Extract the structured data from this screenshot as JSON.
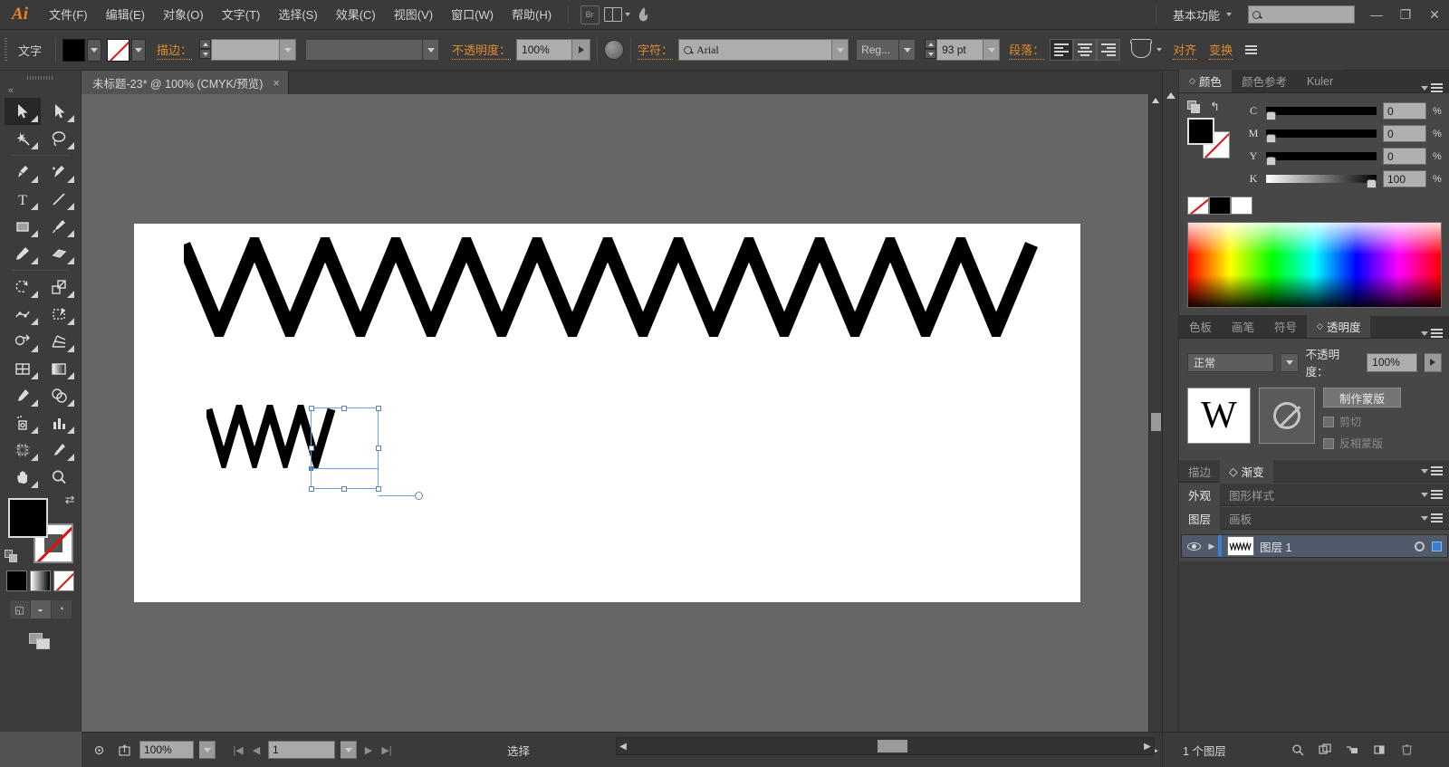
{
  "app": {
    "logo": "Ai"
  },
  "menubar": {
    "items": [
      {
        "label": "文件(F)"
      },
      {
        "label": "编辑(E)"
      },
      {
        "label": "对象(O)"
      },
      {
        "label": "文字(T)"
      },
      {
        "label": "选择(S)"
      },
      {
        "label": "效果(C)"
      },
      {
        "label": "视图(V)"
      },
      {
        "label": "窗口(W)"
      },
      {
        "label": "帮助(H)"
      }
    ],
    "bridge_label": "Br",
    "workspace": "基本功能",
    "search_placeholder": "",
    "window_buttons": {
      "minimize": "—",
      "restore": "❐",
      "close": "✕"
    }
  },
  "controlbar": {
    "tool_label": "文字",
    "fill_swatch": "black",
    "stroke_swatch": "none",
    "stroke_label": "描边：",
    "stroke_weight": "",
    "stroke_profile": "",
    "opacity_label": "不透明度：",
    "opacity_value": "100%",
    "char_label": "字符：",
    "font_family": "Arial",
    "font_style": "Reg...",
    "font_size": "93 pt",
    "paragraph_label": "段落：",
    "align_label": "对齐",
    "transform_label": "变换"
  },
  "documenttab": {
    "title": "未标题-23* @ 100% (CMYK/预览)",
    "close": "×"
  },
  "toolbar": {
    "tools": [
      {
        "name": "selection-tool",
        "active": true
      },
      {
        "name": "direct-selection-tool",
        "active": false
      },
      {
        "name": "magic-wand-tool",
        "active": false
      },
      {
        "name": "lasso-tool",
        "active": false
      },
      {
        "name": "pen-tool",
        "active": false
      },
      {
        "name": "add-anchor-point-tool",
        "active": false
      },
      {
        "name": "type-tool",
        "active": false
      },
      {
        "name": "line-segment-tool",
        "active": false
      },
      {
        "name": "rectangle-tool",
        "active": false
      },
      {
        "name": "paintbrush-tool",
        "active": false
      },
      {
        "name": "pencil-tool",
        "active": false
      },
      {
        "name": "blob-brush-tool",
        "active": false
      },
      {
        "name": "rotate-tool",
        "active": false
      },
      {
        "name": "scale-tool",
        "active": false
      },
      {
        "name": "width-tool",
        "active": false
      },
      {
        "name": "free-transform-tool",
        "active": false
      },
      {
        "name": "shape-builder-tool",
        "active": false
      },
      {
        "name": "perspective-grid-tool",
        "active": false
      },
      {
        "name": "mesh-tool",
        "active": false
      },
      {
        "name": "gradient-tool",
        "active": false
      },
      {
        "name": "eyedropper-tool",
        "active": false
      },
      {
        "name": "blend-tool",
        "active": false
      },
      {
        "name": "symbol-sprayer-tool",
        "active": false
      },
      {
        "name": "column-graph-tool",
        "active": false
      },
      {
        "name": "artboard-tool",
        "active": false
      },
      {
        "name": "slice-tool",
        "active": false
      },
      {
        "name": "hand-tool",
        "active": false
      },
      {
        "name": "zoom-tool",
        "active": false
      }
    ],
    "fill_color": "#000000",
    "stroke_color": "none",
    "color_modes": [
      "color",
      "gradient",
      "none"
    ],
    "draw_modes": [
      "draw-normal",
      "draw-behind",
      "draw-inside"
    ]
  },
  "canvas": {
    "artboard_background": "#ffffff",
    "big_text": "WWWWWWWWWWWW",
    "small_text": "WWW",
    "selection_visible": true
  },
  "panels": {
    "color": {
      "tabs": [
        {
          "label": "颜色",
          "active": true
        },
        {
          "label": "颜色参考",
          "active": false
        },
        {
          "label": "Kuler",
          "active": false
        }
      ],
      "channels": [
        {
          "name": "C",
          "value": "0",
          "unit": "%",
          "percent": 0
        },
        {
          "name": "M",
          "value": "0",
          "unit": "%",
          "percent": 0
        },
        {
          "name": "Y",
          "value": "0",
          "unit": "%",
          "percent": 0
        },
        {
          "name": "K",
          "value": "100",
          "unit": "%",
          "percent": 100
        }
      ]
    },
    "transparency": {
      "tabs": [
        {
          "label": "色板",
          "active": false
        },
        {
          "label": "画笔",
          "active": false
        },
        {
          "label": "符号",
          "active": false
        },
        {
          "label": "透明度",
          "active": true
        }
      ],
      "blend_mode": "正常",
      "opacity_label": "不透明度：",
      "opacity_value": "100%",
      "thumb_char": "W",
      "make_mask_label": "制作蒙版",
      "clip_label": "剪切",
      "invert_mask_label": "反相蒙版"
    },
    "stroke_gradient": {
      "tabs": [
        {
          "label": "描边",
          "active": false
        },
        {
          "label": "渐变",
          "active": true
        }
      ]
    },
    "appearance": {
      "tabs": [
        {
          "label": "外观",
          "active": true
        },
        {
          "label": "图形样式",
          "active": false
        }
      ]
    },
    "layers": {
      "tabs": [
        {
          "label": "图层",
          "active": true
        },
        {
          "label": "画板",
          "active": false
        }
      ],
      "rows": [
        {
          "name": "图层 1",
          "visible": true,
          "selected": true,
          "color": "#3a7fd5"
        }
      ]
    }
  },
  "statusbar": {
    "zoom": "100%",
    "page": "1",
    "status_text": "选择",
    "layer_count": "1 个图层"
  }
}
